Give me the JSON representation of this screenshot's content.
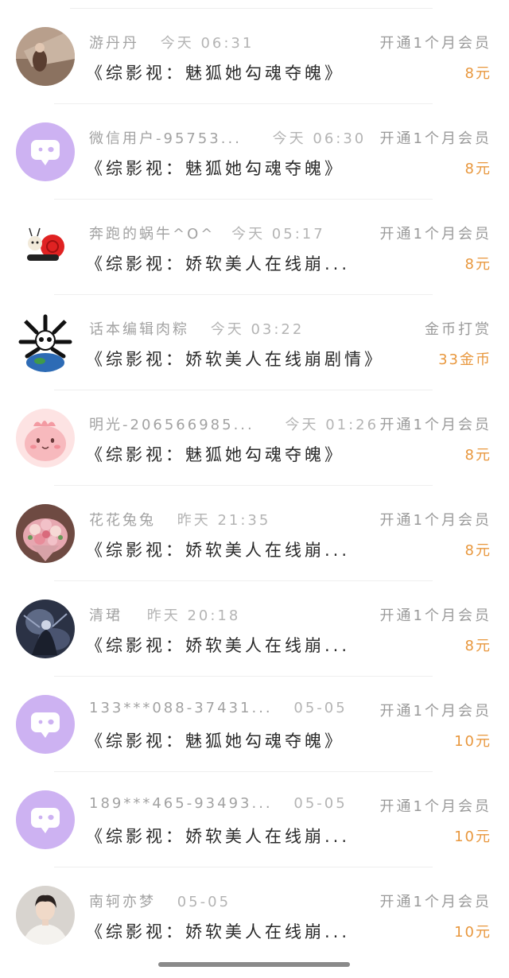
{
  "rows": [
    {
      "avatar": "photo-avatar",
      "name": "游丹丹",
      "time": "今天 06:31",
      "book": "《综影视：魅狐她勾魂夺魄》",
      "action": "开通1个月会员",
      "price": "8元"
    },
    {
      "avatar": "default-chat-avatar",
      "name": "微信用户-95753...",
      "time": "今天 06:30",
      "book": "《综影视：魅狐她勾魂夺魄》",
      "action": "开通1个月会员",
      "price": "8元"
    },
    {
      "avatar": "snail-avatar",
      "name": "奔跑的蜗牛^O^",
      "time": "今天 05:17",
      "book": "《综影视：娇软美人在线崩...",
      "action": "开通1个月会员",
      "price": "8元"
    },
    {
      "avatar": "panda-globe-avatar",
      "name": "话本编辑肉粽",
      "time": "今天 03:22",
      "book": "《综影视：娇软美人在线崩剧情》",
      "action": "金币打赏",
      "price": "33金币"
    },
    {
      "avatar": "pink-creature-avatar",
      "name": "明光-206566985...",
      "time": "今天 01:26",
      "book": "《综影视：魅狐她勾魂夺魄》",
      "action": "开通1个月会员",
      "price": "8元"
    },
    {
      "avatar": "flower-bouquet-avatar",
      "name": "花花兔兔",
      "time": "昨天 21:35",
      "book": "《综影视：娇软美人在线崩...",
      "action": "开通1个月会员",
      "price": "8元"
    },
    {
      "avatar": "dark-art-avatar",
      "name": "清珺",
      "time": "昨天 20:18",
      "book": "《综影视：娇软美人在线崩...",
      "action": "开通1个月会员",
      "price": "8元"
    },
    {
      "avatar": "default-chat-avatar",
      "name": "133***088-37431...",
      "time": "05-05",
      "book": "《综影视：魅狐她勾魂夺魄》",
      "action": "开通1个月会员",
      "price": "10元"
    },
    {
      "avatar": "default-chat-avatar",
      "name": "189***465-93493...",
      "time": "05-05",
      "book": "《综影视：娇软美人在线崩...",
      "action": "开通1个月会员",
      "price": "10元"
    },
    {
      "avatar": "portrait-avatar",
      "name": "南轲亦梦",
      "time": "05-05",
      "book": "《综影视：娇软美人在线崩...",
      "action": "开通1个月会员",
      "price": "10元"
    }
  ],
  "colors": {
    "price": "#e8973d",
    "meta": "#a2a2a2",
    "book": "#2a2a2a",
    "default_avatar_bg": "#cdb2f2"
  }
}
